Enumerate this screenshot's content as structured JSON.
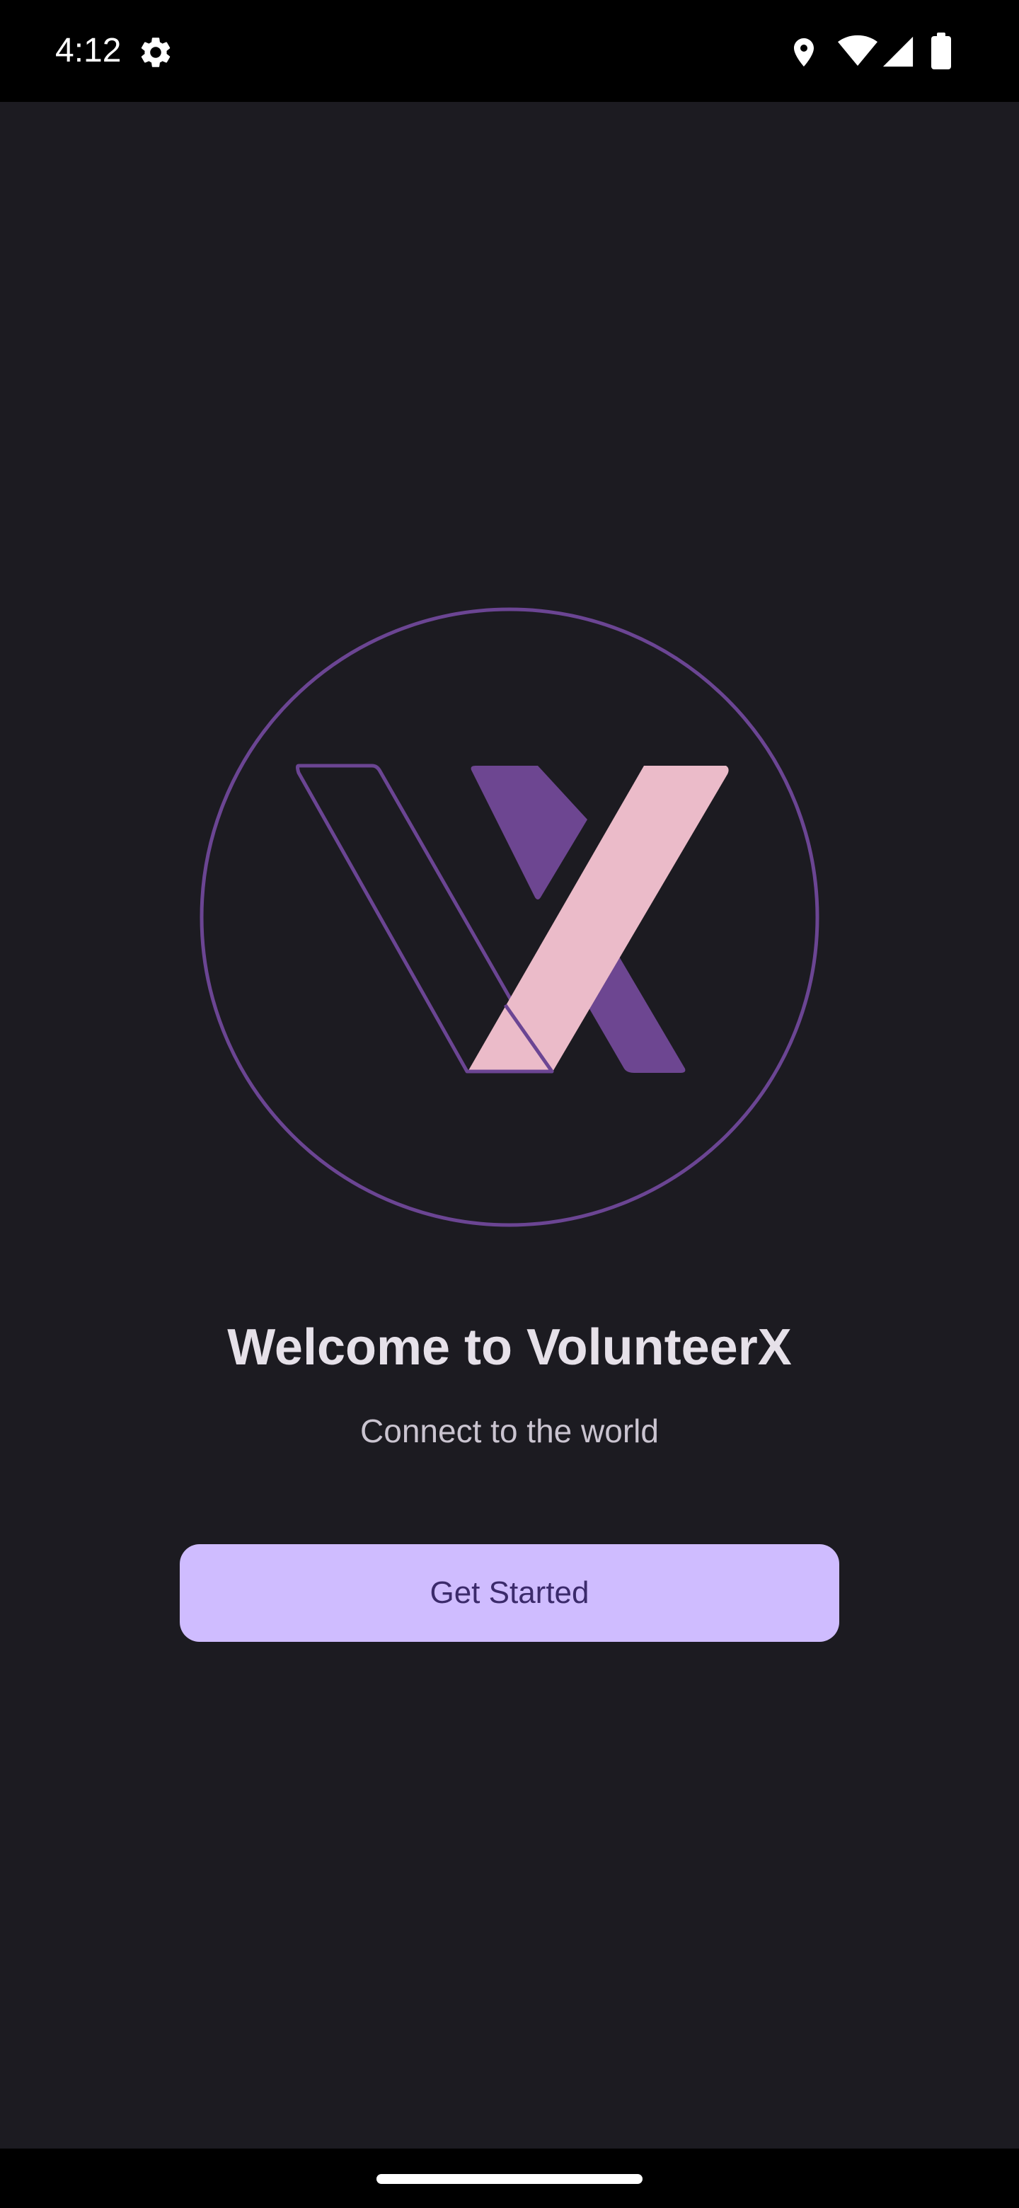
{
  "status_bar": {
    "time": "4:12",
    "icons": [
      "settings-gear-icon",
      "location-icon",
      "wifi-icon",
      "cellular-signal-icon",
      "battery-icon"
    ]
  },
  "logo": {
    "icon": "volunteerx-logo-icon",
    "colors": {
      "ring": "#6b4593",
      "outline": "#6b4593",
      "dark_accent": "#6d4691",
      "light_accent": "#ebbbc9"
    }
  },
  "welcome": {
    "title": "Welcome to VolunteerX",
    "subtitle": "Connect to the world"
  },
  "actions": {
    "get_started_label": "Get Started"
  },
  "colors": {
    "background": "#1c1b21",
    "button_background": "#cfbcff",
    "button_text": "#3b2a6b",
    "title_text": "#e6e1e9",
    "subtitle_text": "#cac4d0"
  }
}
